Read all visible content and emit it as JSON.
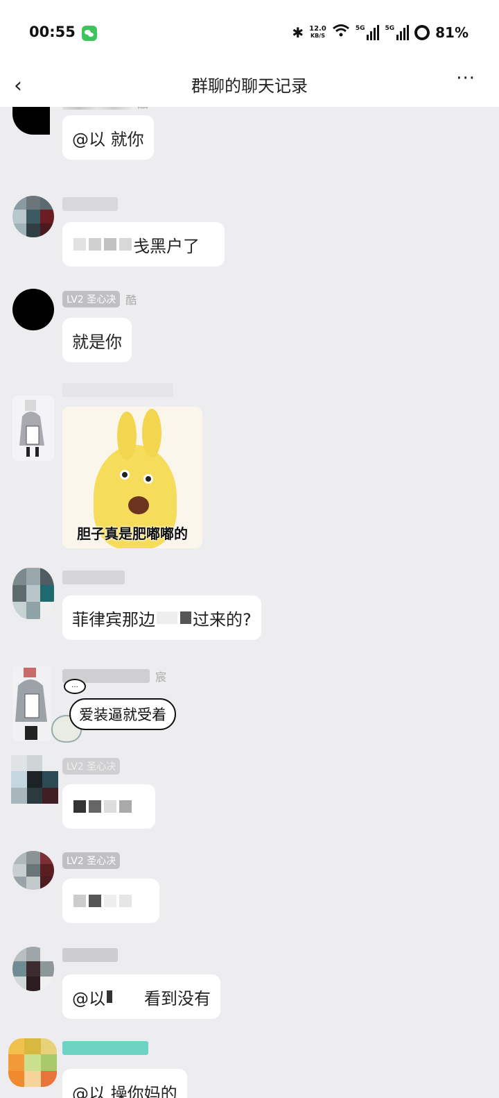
{
  "status_bar": {
    "time": "00:55",
    "net_speed_value": "12.0",
    "net_speed_unit": "KB/S",
    "sim1": "5G",
    "sim2": "5G",
    "battery": "81%"
  },
  "nav": {
    "back_glyph": "‹",
    "title": "群聊的聊天记录",
    "more_glyph": "···"
  },
  "messages": [
    {
      "nick": "酷",
      "text_a": "@以 就你"
    },
    {
      "text_b_visible": "戋黑户了"
    },
    {
      "badge": "LV2 圣心决",
      "nick": "酷",
      "text": "就是你"
    },
    {
      "sticker_caption": "胆子真是肥嘟嘟的"
    },
    {
      "text_pre": "菲律宾那边",
      "text_post": "过来的?"
    },
    {
      "nick": "宸",
      "sticker_text": "爱装逼就受着",
      "thought_text": "..."
    },
    {
      "badge": "LV2 圣心决"
    },
    {
      "badge": "LV2 圣心决"
    },
    {
      "text_pre": "@以",
      "text_post": "看到没有"
    },
    {
      "text_partial": "@以 操你妈的"
    }
  ],
  "colors": {
    "background": "#ededf0",
    "bubble": "#ffffff",
    "badge": "#c0c0c4",
    "accent_teal": "#6fd3c3"
  },
  "icons": [
    "wechat-notification-icon",
    "bluetooth-icon",
    "wifi-icon",
    "signal-icon",
    "battery-icon",
    "back-icon",
    "more-icon"
  ]
}
